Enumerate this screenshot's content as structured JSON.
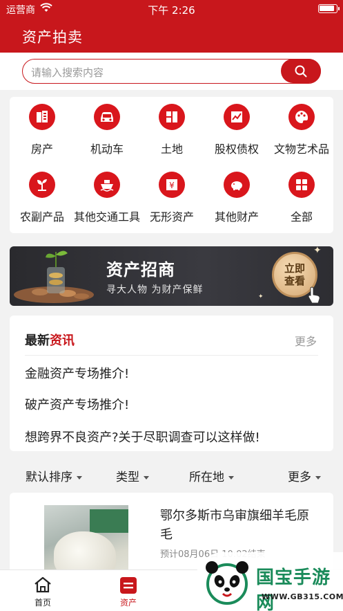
{
  "status": {
    "carrier": "运营商",
    "time": "下午 2:26"
  },
  "nav": {
    "title": "资产拍卖"
  },
  "search": {
    "placeholder": "请输入搜索内容"
  },
  "categories": [
    {
      "label": "房产",
      "icon": "building-icon"
    },
    {
      "label": "机动车",
      "icon": "car-icon"
    },
    {
      "label": "土地",
      "icon": "land-icon"
    },
    {
      "label": "股权债权",
      "icon": "chart-icon"
    },
    {
      "label": "文物艺术品",
      "icon": "palette-icon"
    },
    {
      "label": "农副产品",
      "icon": "sprout-icon"
    },
    {
      "label": "其他交通工具",
      "icon": "ship-icon"
    },
    {
      "label": "无形资产",
      "icon": "yen-icon"
    },
    {
      "label": "其他财产",
      "icon": "piggy-bank-icon"
    },
    {
      "label": "全部",
      "icon": "grid-icon"
    }
  ],
  "banner": {
    "title": "资产招商",
    "subtitle": "寻大人物 为财产保鲜",
    "cta_line1": "立即",
    "cta_line2": "查看"
  },
  "news": {
    "title_part1": "最新",
    "title_part2": "资讯",
    "more": "更多",
    "items": [
      "金融资产专场推介!",
      "破产资产专场推介!",
      "想跨界不良资产?关于尽职调查可以这样做!"
    ]
  },
  "filters": [
    "默认排序",
    "类型",
    "所在地",
    "更多"
  ],
  "product": {
    "title": "鄂尔多斯市乌审旗细羊毛原毛",
    "date": "预计08月06日 10:02结束"
  },
  "tabs": [
    {
      "label": "首页",
      "icon": "home-icon"
    },
    {
      "label": "资产",
      "icon": "asset-icon"
    }
  ],
  "watermark": {
    "name": "国宝手游网",
    "url": "WWW.GB315.COM"
  },
  "colors": {
    "brand": "#c8171c",
    "banner_bg": "#2f2f35",
    "watermark_green": "#1a8b5a"
  }
}
